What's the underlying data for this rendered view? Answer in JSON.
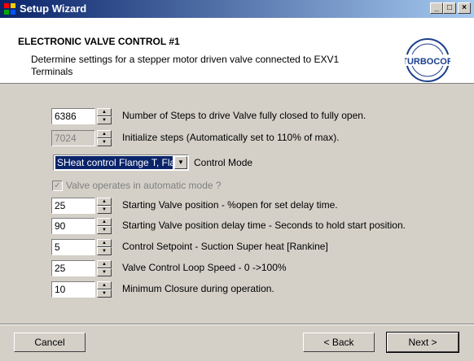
{
  "window": {
    "title": "Setup Wizard",
    "controls": {
      "minimize": "_",
      "maximize": "□",
      "close": "×"
    }
  },
  "header": {
    "title": "ELECTRONIC VALVE CONTROL #1",
    "description": "Determine settings for a stepper motor driven valve connected to EXV1 Terminals",
    "logo_text": "TURBOCOR"
  },
  "settings": [
    {
      "value": "6386",
      "label": "Number of Steps to drive Valve fully closed to fully open.",
      "disabled": false
    },
    {
      "value": "7024",
      "label": "Initialize steps (Automatically set to 110% of max).",
      "disabled": true
    }
  ],
  "control_mode": {
    "selected": "SHeat control Flange T, Flang",
    "label": "Control Mode"
  },
  "auto_mode_checkbox": {
    "label": "Valve operates in automatic mode ?",
    "checked": true
  },
  "params": [
    {
      "value": "25",
      "label": "Starting Valve position - %open for set delay time."
    },
    {
      "value": "90",
      "label": "Starting Valve position delay time - Seconds to hold start position."
    },
    {
      "value": "5",
      "label": "Control Setpoint - Suction Super heat [Rankine]"
    },
    {
      "value": "25",
      "label": "Valve Control Loop Speed - 0 ->100%"
    },
    {
      "value": "10",
      "label": "Minimum Closure during operation."
    }
  ],
  "buttons": {
    "cancel": "Cancel",
    "back": "< Back",
    "next": "Next >"
  }
}
